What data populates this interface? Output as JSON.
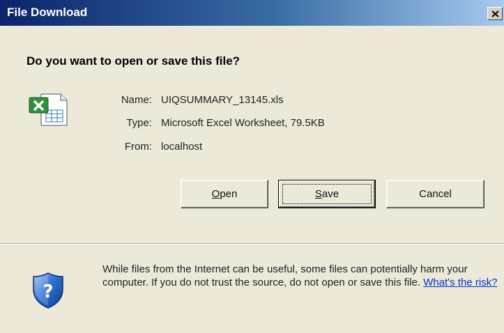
{
  "window": {
    "title": "File Download",
    "close_glyph": "✕"
  },
  "prompt": {
    "question": "Do you want to open or save this file?"
  },
  "file": {
    "icon": "excel-file-icon",
    "name_label": "Name:",
    "name_value": "UIQSUMMARY_13145.xls",
    "type_label": "Type:",
    "type_value": "Microsoft Excel Worksheet, 79.5KB",
    "from_label": "From:",
    "from_value": "localhost"
  },
  "buttons": {
    "open_mnemonic": "O",
    "open_rest": "pen",
    "save_mnemonic": "S",
    "save_rest": "ave",
    "cancel_label": "Cancel"
  },
  "warning": {
    "icon": "shield-question-icon",
    "text": "While files from the Internet can be useful, some files can potentially harm your computer. If you do not trust the source, do not open or save this file.",
    "link_text": "What's the risk?"
  },
  "colors": {
    "titlebar_start": "#0a246a",
    "titlebar_end": "#a6caf0",
    "dialog_bg": "#ece9d8",
    "link": "#0033cc"
  }
}
